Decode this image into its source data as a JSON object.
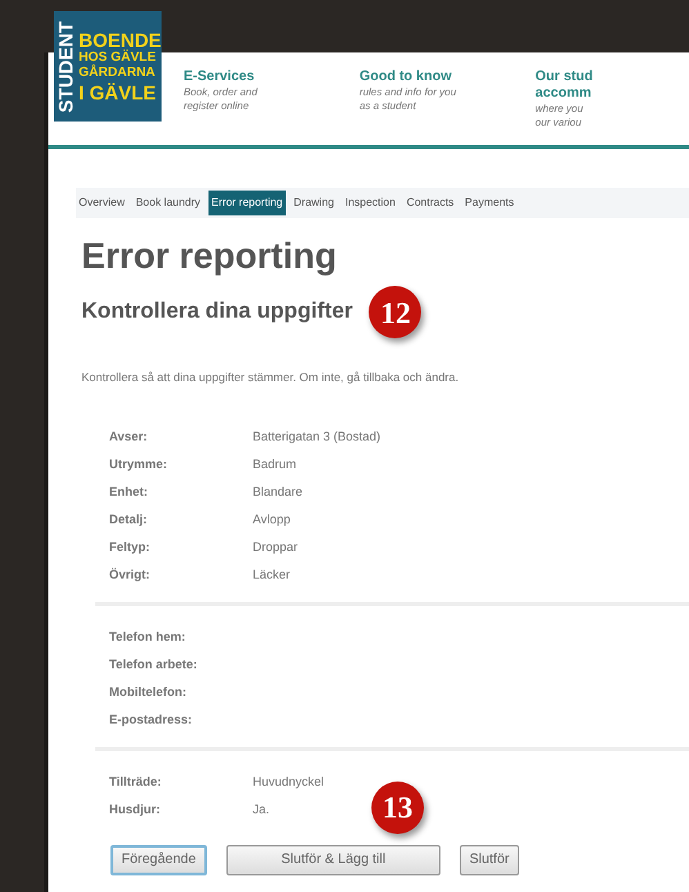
{
  "logo": {
    "vertical": "STUDENT",
    "lines": [
      "BOENDE",
      "HOS GÄVLE",
      "GÅRDARNA",
      "I GÄVLE"
    ]
  },
  "header_links": [
    {
      "title": "E-Services",
      "lines": [
        "Book, order and",
        "register online"
      ]
    },
    {
      "title": "Good to know",
      "lines": [
        "rules and info for you",
        "as a student"
      ]
    },
    {
      "title": "Our stud",
      "title2": "accomm",
      "lines": [
        "where you",
        "our variou"
      ]
    }
  ],
  "tabs": [
    {
      "label": "Overview",
      "selected": false
    },
    {
      "label": "Book laundry",
      "selected": false
    },
    {
      "label": "Error reporting",
      "selected": true
    },
    {
      "label": "Drawing",
      "selected": false
    },
    {
      "label": "Inspection",
      "selected": false
    },
    {
      "label": "Contracts",
      "selected": false
    },
    {
      "label": "Payments",
      "selected": false
    }
  ],
  "title": "Error reporting",
  "subtitle": "Kontrollera dina uppgifter",
  "callouts": [
    "12",
    "13"
  ],
  "intro": "Kontrollera så att dina uppgifter stämmer. Om inte, gå tillbaka och ändra.",
  "groups": [
    [
      {
        "label": "Avser:",
        "value": "Batterigatan 3 (Bostad)"
      },
      {
        "label": "Utrymme:",
        "value": "Badrum"
      },
      {
        "label": "Enhet:",
        "value": "Blandare"
      },
      {
        "label": "Detalj:",
        "value": "Avlopp"
      },
      {
        "label": "Feltyp:",
        "value": "Droppar"
      },
      {
        "label": "Övrigt:",
        "value": "Läcker"
      }
    ],
    [
      {
        "label": "Telefon hem:"
      },
      {
        "label": "Telefon arbete:"
      },
      {
        "label": "Mobiltelefon:"
      },
      {
        "label": "E-postadress:"
      }
    ],
    [
      {
        "label": "Tillträde:",
        "value": "Huvudnyckel"
      },
      {
        "label": "Husdjur:",
        "value": "Ja."
      }
    ]
  ],
  "buttons": [
    {
      "label": "Föregående",
      "focused": true
    },
    {
      "label": "Slutför & Lägg till",
      "focused": false
    },
    {
      "label": "Slutför",
      "focused": false
    }
  ]
}
